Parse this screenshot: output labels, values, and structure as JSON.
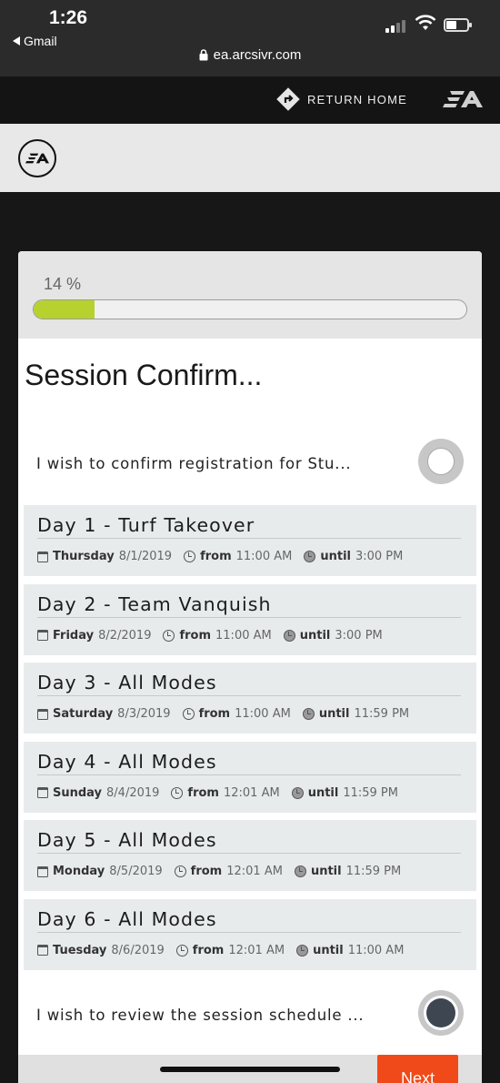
{
  "status_bar": {
    "time": "1:26",
    "back_app": "Gmail",
    "url": "ea.arcsivr.com"
  },
  "topnav": {
    "return_home": "RETURN HOME",
    "logo": "EA"
  },
  "brand": {
    "logo": "EA"
  },
  "progress": {
    "label": "14 %",
    "value": 0.14,
    "fill_color": "#b7d12f"
  },
  "page_title": "Session Confirm...",
  "confirm_text": "I wish to confirm registration for Stu...",
  "days": [
    {
      "title": "Day 1 - Turf Takeover",
      "date_day": "Thursday",
      "date": "8/1/2019",
      "from_label": "from",
      "from": "11:00 AM",
      "until_label": "until",
      "until": "3:00 PM"
    },
    {
      "title": "Day 2 - Team Vanquish",
      "date_day": "Friday",
      "date": "8/2/2019",
      "from_label": "from",
      "from": "11:00 AM",
      "until_label": "until",
      "until": "3:00 PM"
    },
    {
      "title": "Day 3 - All Modes",
      "date_day": "Saturday",
      "date": "8/3/2019",
      "from_label": "from",
      "from": "11:00 AM",
      "until_label": "until",
      "until": "11:59 PM"
    },
    {
      "title": "Day 4 - All Modes",
      "date_day": "Sunday",
      "date": "8/4/2019",
      "from_label": "from",
      "from": "12:01 AM",
      "until_label": "until",
      "until": "11:59 PM"
    },
    {
      "title": "Day 5 - All Modes",
      "date_day": "Monday",
      "date": "8/5/2019",
      "from_label": "from",
      "from": "12:01 AM",
      "until_label": "until",
      "until": "11:59 PM"
    },
    {
      "title": "Day 6 - All Modes",
      "date_day": "Tuesday",
      "date": "8/6/2019",
      "from_label": "from",
      "from": "12:01 AM",
      "until_label": "until",
      "until": "11:00 AM"
    }
  ],
  "review_text": "I wish to review the session schedule ...",
  "next_label": "Next",
  "colors": {
    "accent": "#f04a1a",
    "progress": "#b7d12f"
  }
}
